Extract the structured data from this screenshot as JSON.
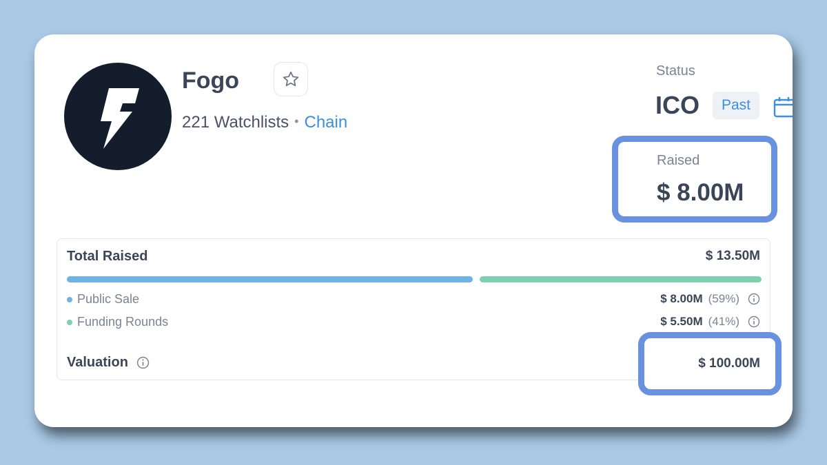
{
  "project": {
    "name": "Fogo",
    "watchlists": "221 Watchlists",
    "separator": "•",
    "category_link": "Chain",
    "logo_icon": "lightning-bolt-icon"
  },
  "status": {
    "label": "Status",
    "value": "ICO",
    "badge": "Past"
  },
  "raised": {
    "label": "Raised",
    "value": "$ 8.00M"
  },
  "funding": {
    "total_label": "Total Raised",
    "total_value": "$ 13.50M",
    "segments": [
      {
        "name": "Public Sale",
        "amount": "$ 8.00M",
        "percent": "(59%)",
        "share": 0.59,
        "color": "#6cb4e8"
      },
      {
        "name": "Funding Rounds",
        "amount": "$ 5.50M",
        "percent": "(41%)",
        "share": 0.41,
        "color": "#7fd0ae"
      }
    ],
    "valuation_label": "Valuation",
    "valuation_value": "$ 100.00M"
  },
  "colors": {
    "accent": "#3b8ee0",
    "highlight_border": "#6892e0",
    "background": "#a9c9e6"
  }
}
